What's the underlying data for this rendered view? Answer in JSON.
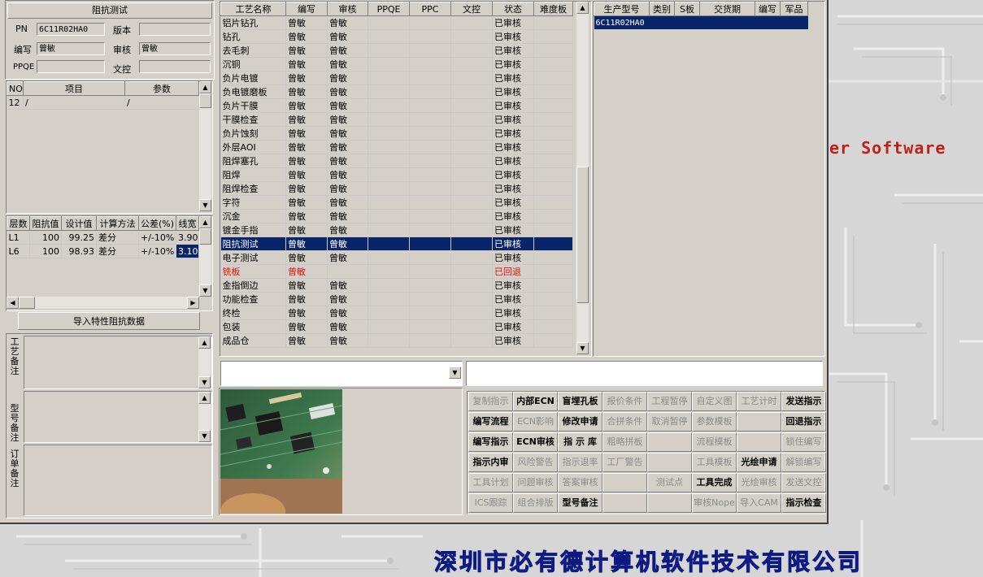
{
  "desktop": {
    "watermark_text": "er Software",
    "company_name": "深圳市必有德计算机软件技术有限公司"
  },
  "impedance": {
    "title": "阻抗测试",
    "pn_label": "PN",
    "pn_value": "6C11R02HA0",
    "version_label": "版本",
    "version_value": "",
    "author_label": "编写",
    "author_value": "曾敏",
    "review_label": "审核",
    "review_value": "曾敏",
    "ppqe_label": "PPQE",
    "ppqe_value": "",
    "doc_label": "文控",
    "doc_value": ""
  },
  "params": {
    "headers": [
      "NO",
      "项目",
      "参数"
    ],
    "rows": [
      {
        "no": "12",
        "item": "/",
        "param": "/"
      }
    ]
  },
  "layers": {
    "headers": [
      "层数",
      "阻抗值",
      "设计值",
      "计算方法",
      "公差(%)",
      "线宽"
    ],
    "rows": [
      {
        "layer": "L1",
        "imp": "100",
        "design": "99.25",
        "method": "差分",
        "tol": "+/-10%",
        "width": "3.90"
      },
      {
        "layer": "L6",
        "imp": "100",
        "design": "98.93",
        "method": "差分",
        "tol": "+/-10%",
        "width": "3.10"
      }
    ]
  },
  "import_button": "导入特性阻抗数据",
  "notes": {
    "process_label": "工艺备注",
    "model_label": "型号备注",
    "order_label": "订单备注"
  },
  "process": {
    "headers": [
      "工艺名称",
      "编写",
      "审核",
      "PPQE",
      "PPC",
      "文控",
      "状态",
      "难度板"
    ],
    "rows": [
      {
        "name": "铝片钻孔",
        "author": "曾敏",
        "review": "曾敏",
        "status": "已审核"
      },
      {
        "name": "钻孔",
        "author": "曾敏",
        "review": "曾敏",
        "status": "已审核"
      },
      {
        "name": "去毛刺",
        "author": "曾敏",
        "review": "曾敏",
        "status": "已审核"
      },
      {
        "name": "沉铜",
        "author": "曾敏",
        "review": "曾敏",
        "status": "已审核"
      },
      {
        "name": "负片电镀",
        "author": "曾敏",
        "review": "曾敏",
        "status": "已审核"
      },
      {
        "name": "负电镀磨板",
        "author": "曾敏",
        "review": "曾敏",
        "status": "已审核"
      },
      {
        "name": "负片干膜",
        "author": "曾敏",
        "review": "曾敏",
        "status": "已审核"
      },
      {
        "name": "干膜检查",
        "author": "曾敏",
        "review": "曾敏",
        "status": "已审核"
      },
      {
        "name": "负片蚀刻",
        "author": "曾敏",
        "review": "曾敏",
        "status": "已审核"
      },
      {
        "name": "外层AOI",
        "author": "曾敏",
        "review": "曾敏",
        "status": "已审核"
      },
      {
        "name": "阻焊塞孔",
        "author": "曾敏",
        "review": "曾敏",
        "status": "已审核"
      },
      {
        "name": "阻焊",
        "author": "曾敏",
        "review": "曾敏",
        "status": "已审核"
      },
      {
        "name": "阻焊检查",
        "author": "曾敏",
        "review": "曾敏",
        "status": "已审核"
      },
      {
        "name": "字符",
        "author": "曾敏",
        "review": "曾敏",
        "status": "已审核"
      },
      {
        "name": "沉金",
        "author": "曾敏",
        "review": "曾敏",
        "status": "已审核"
      },
      {
        "name": "镀金手指",
        "author": "曾敏",
        "review": "曾敏",
        "status": "已审核"
      },
      {
        "name": "阻抗测试",
        "author": "曾敏",
        "review": "曾敏",
        "status": "已审核",
        "selected": true
      },
      {
        "name": "电子测试",
        "author": "曾敏",
        "review": "曾敏",
        "status": "已审核"
      },
      {
        "name": "铣板",
        "author": "曾敏",
        "review": "",
        "status": "已回退",
        "rejected": true
      },
      {
        "name": "金指倒边",
        "author": "曾敏",
        "review": "曾敏",
        "status": "已审核"
      },
      {
        "name": "功能检查",
        "author": "曾敏",
        "review": "曾敏",
        "status": "已审核"
      },
      {
        "name": "终检",
        "author": "曾敏",
        "review": "曾敏",
        "status": "已审核"
      },
      {
        "name": "包装",
        "author": "曾敏",
        "review": "曾敏",
        "status": "已审核"
      },
      {
        "name": "成品仓",
        "author": "曾敏",
        "review": "曾敏",
        "status": "已审核"
      }
    ]
  },
  "models": {
    "headers": [
      "生产型号",
      "类别",
      "S板",
      "交货期",
      "编写",
      "军品"
    ],
    "rows": [
      {
        "model": "6C11R02HA0"
      }
    ]
  },
  "buttons": [
    {
      "label": "复制指示",
      "enabled": false
    },
    {
      "label": "内部ECN",
      "enabled": true
    },
    {
      "label": "盲埋孔板",
      "enabled": true
    },
    {
      "label": "报价条件",
      "enabled": false
    },
    {
      "label": "工程暂停",
      "enabled": false
    },
    {
      "label": "自定义图",
      "enabled": false
    },
    {
      "label": "工艺计时",
      "enabled": false
    },
    {
      "label": "发送指示",
      "enabled": true
    },
    {
      "label": "编写流程",
      "enabled": true
    },
    {
      "label": "ECN影响",
      "enabled": false
    },
    {
      "label": "修改申请",
      "enabled": true
    },
    {
      "label": "合拼条件",
      "enabled": false
    },
    {
      "label": "取消暂停",
      "enabled": false
    },
    {
      "label": "参数模板",
      "enabled": false
    },
    {
      "label": "",
      "enabled": false
    },
    {
      "label": "回退指示",
      "enabled": true
    },
    {
      "label": "编写指示",
      "enabled": true
    },
    {
      "label": "ECN审核",
      "enabled": true
    },
    {
      "label": "指 示 库",
      "enabled": true
    },
    {
      "label": "粗略拼板",
      "enabled": false
    },
    {
      "label": "",
      "enabled": false
    },
    {
      "label": "流程模板",
      "enabled": false
    },
    {
      "label": "",
      "enabled": false
    },
    {
      "label": "锁住编写",
      "enabled": false
    },
    {
      "label": "指示内审",
      "enabled": true
    },
    {
      "label": "风险警告",
      "enabled": false
    },
    {
      "label": "指示退率",
      "enabled": false
    },
    {
      "label": "工厂警告",
      "enabled": false
    },
    {
      "label": "",
      "enabled": false
    },
    {
      "label": "工具模板",
      "enabled": false
    },
    {
      "label": "光绘申请",
      "enabled": true
    },
    {
      "label": "解锁编写",
      "enabled": false
    },
    {
      "label": "工具计划",
      "enabled": false
    },
    {
      "label": "问题审核",
      "enabled": false
    },
    {
      "label": "答案审核",
      "enabled": false
    },
    {
      "label": "",
      "enabled": false
    },
    {
      "label": "测试点",
      "enabled": false
    },
    {
      "label": "工具完成",
      "enabled": true
    },
    {
      "label": "光绘审核",
      "enabled": false
    },
    {
      "label": "发送文控",
      "enabled": false
    },
    {
      "label": "ICS跟踪",
      "enabled": false
    },
    {
      "label": "组合排版",
      "enabled": false
    },
    {
      "label": "型号备注",
      "enabled": true
    },
    {
      "label": "",
      "enabled": false
    },
    {
      "label": "",
      "enabled": false
    },
    {
      "label": "审核Nope",
      "enabled": false
    },
    {
      "label": "导入CAM",
      "enabled": false
    },
    {
      "label": "指示检查",
      "enabled": true
    }
  ],
  "combo": {
    "value": ""
  },
  "search": {
    "value": ""
  }
}
